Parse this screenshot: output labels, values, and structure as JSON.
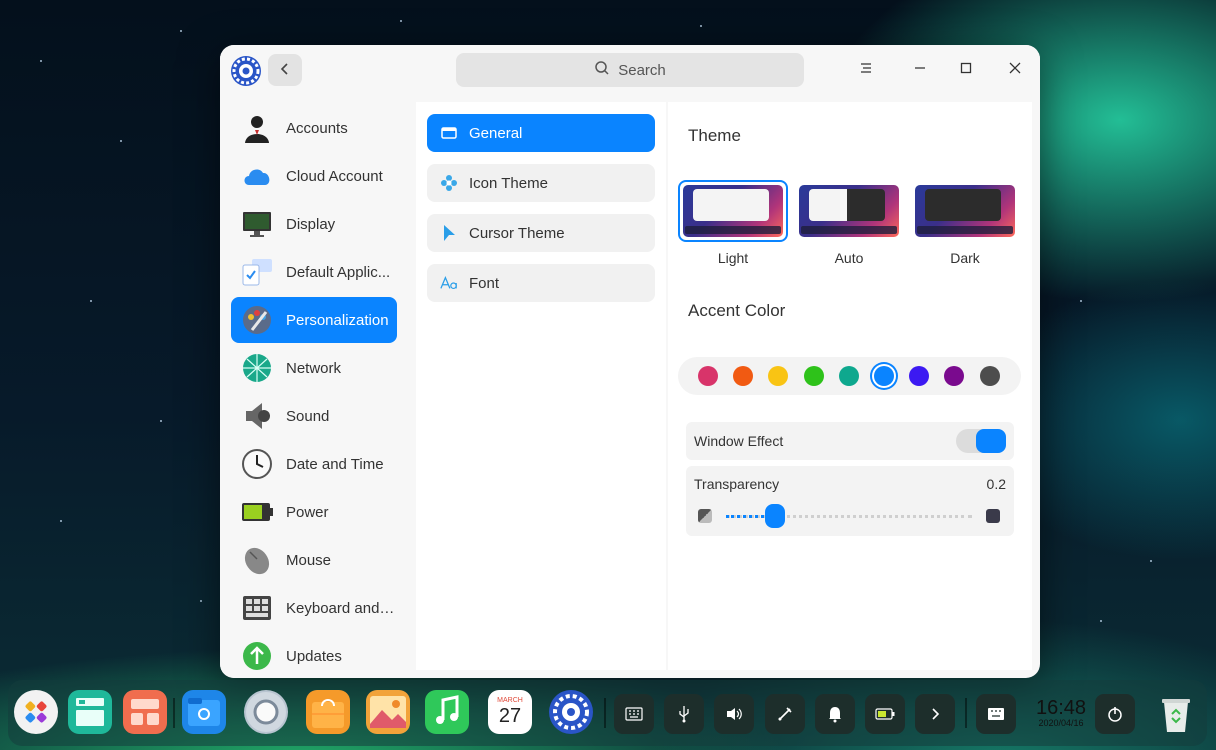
{
  "window": {
    "search_placeholder": "Search"
  },
  "sidebar": {
    "items": [
      {
        "label": "Accounts",
        "icon": "accounts-icon"
      },
      {
        "label": "Cloud Account",
        "icon": "cloud-icon"
      },
      {
        "label": "Display",
        "icon": "display-icon"
      },
      {
        "label": "Default Applic...",
        "icon": "default-apps-icon"
      },
      {
        "label": "Personalization",
        "icon": "personalization-icon"
      },
      {
        "label": "Network",
        "icon": "network-icon"
      },
      {
        "label": "Sound",
        "icon": "sound-icon"
      },
      {
        "label": "Date and Time",
        "icon": "clock-icon"
      },
      {
        "label": "Power",
        "icon": "battery-icon"
      },
      {
        "label": "Mouse",
        "icon": "mouse-icon"
      },
      {
        "label": "Keyboard and ...",
        "icon": "keyboard-icon"
      },
      {
        "label": "Updates",
        "icon": "update-icon"
      }
    ],
    "active_index": 4
  },
  "subnav": {
    "items": [
      {
        "label": "General",
        "icon": "window-icon"
      },
      {
        "label": "Icon Theme",
        "icon": "flower-icon"
      },
      {
        "label": "Cursor Theme",
        "icon": "cursor-icon"
      },
      {
        "label": "Font",
        "icon": "font-icon"
      }
    ],
    "active_index": 0
  },
  "theme": {
    "title": "Theme",
    "options": [
      {
        "label": "Light",
        "selected": true
      },
      {
        "label": "Auto",
        "selected": false
      },
      {
        "label": "Dark",
        "selected": false
      }
    ]
  },
  "accent": {
    "title": "Accent Color",
    "colors": [
      "#d8346a",
      "#f15a12",
      "#f9c414",
      "#2ec21a",
      "#0ea88e",
      "#0a84ff",
      "#3c19f2",
      "#7a0a8e",
      "#4d4d4d"
    ],
    "selected_index": 5
  },
  "window_effect": {
    "label": "Window Effect",
    "enabled": true
  },
  "transparency": {
    "label": "Transparency",
    "value": "0.2",
    "fraction": 0.2
  },
  "dock": {
    "calendar_month": "MARCH",
    "calendar_day": "27",
    "clock_time": "16:48",
    "clock_date": "2020/04/16"
  },
  "colors": {
    "accent": "#0a84ff"
  }
}
